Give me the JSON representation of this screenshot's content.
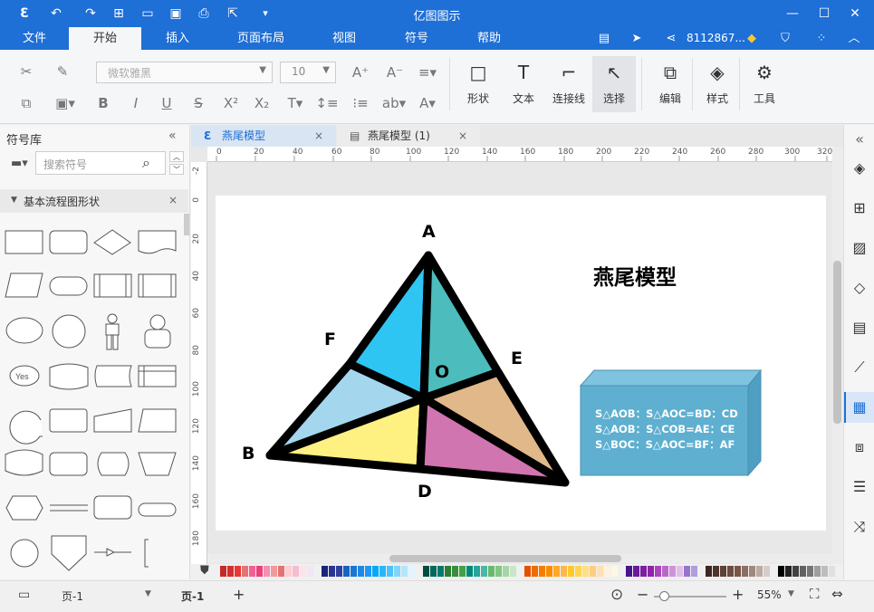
{
  "app": {
    "title": "亿图图示"
  },
  "titlebar": {
    "icons": [
      "app-logo-icon",
      "undo-icon",
      "redo-icon",
      "new-icon",
      "open-icon",
      "save-icon",
      "print-icon",
      "export-icon",
      "more-icon"
    ],
    "window": [
      "minimize-icon",
      "maximize-icon",
      "close-icon"
    ]
  },
  "menu": {
    "items": [
      "文件",
      "开始",
      "插入",
      "页面布局",
      "视图",
      "符号",
      "帮助"
    ],
    "active": "开始",
    "user": "8112867..."
  },
  "ribbon": {
    "font": "微软雅黑",
    "size": "10",
    "buttons": [
      {
        "name": "shape",
        "label": "形状",
        "icon": "□"
      },
      {
        "name": "text",
        "label": "文本",
        "icon": "T"
      },
      {
        "name": "connector",
        "label": "连接线",
        "icon": "⌐"
      },
      {
        "name": "select",
        "label": "选择",
        "icon": "↖"
      },
      {
        "name": "edit",
        "label": "编辑",
        "icon": "⧉"
      },
      {
        "name": "style",
        "label": "样式",
        "icon": "◈"
      },
      {
        "name": "tools",
        "label": "工具",
        "icon": "⚙"
      }
    ]
  },
  "library": {
    "title": "符号库",
    "search_placeholder": "搜索符号",
    "section": "基本流程图形状"
  },
  "tabs": [
    {
      "label": "燕尾模型",
      "active": true
    },
    {
      "label": "燕尾模型 (1)",
      "active": false
    }
  ],
  "ruler": {
    "h": [
      "0",
      "20",
      "40",
      "60",
      "80",
      "100",
      "120",
      "140",
      "160",
      "180",
      "200",
      "220",
      "240",
      "260",
      "280",
      "300",
      "320"
    ],
    "v": [
      "-2",
      "0",
      "20",
      "40",
      "60",
      "80",
      "100",
      "120",
      "140",
      "160",
      "180"
    ]
  },
  "diagram": {
    "title": "燕尾模型",
    "labels": {
      "A": "A",
      "B": "B",
      "D": "D",
      "E": "E",
      "F": "F",
      "O": "O"
    },
    "formula": [
      "S△AOB：S△AOC=BD：CD",
      "S△AOB：S△COB=AE：CE",
      "S△BOC：S△AOC=BF：AF"
    ]
  },
  "colors": {
    "brand": "#1e6fd6",
    "tri_top_left": "#2ec5f3",
    "tri_top_right": "#4cbcbc",
    "tri_left": "#a4d6ee",
    "tri_right": "#e0b88a",
    "tri_bottom_left": "#fff082",
    "tri_bottom_right": "#d075b0",
    "box": "#5eafd0"
  },
  "status": {
    "page_select": "页-1",
    "page_tab": "页-1",
    "zoom": "55%"
  }
}
